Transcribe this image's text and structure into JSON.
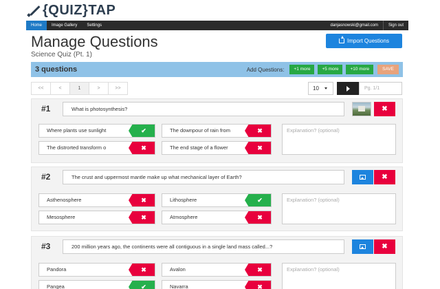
{
  "app": {
    "logo_text": "{QUIZ}TAP"
  },
  "nav": {
    "home": "Home",
    "gallery": "Image Gallery",
    "settings": "Settings",
    "email": "danjasnowski@gmail.com",
    "signout": "Sign out"
  },
  "page": {
    "title": "Manage Questions",
    "subtitle": "Science Quiz (Pt. 1)",
    "import_label": "Import Questions"
  },
  "qbar": {
    "count": "3 questions",
    "add_label": "Add Questions:",
    "add_buttons": [
      "+1 more",
      "+5 more",
      "+10 more"
    ],
    "save": "SAVE"
  },
  "pager": {
    "first": "<<",
    "prev": "<",
    "current": "1",
    "next": ">",
    "last": ">>",
    "per_page": "10",
    "page_placeholder": "Pg. 1/1"
  },
  "colors": {
    "accent": "#1d84de",
    "correct": "#25b04c",
    "wrong": "#e8003d",
    "nav_bg": "#2b2b2b",
    "qbar_bg": "#8fc2e7"
  },
  "questions": [
    {
      "number": "#1",
      "text": "What is photosynthesis?",
      "has_image": true,
      "answers": [
        {
          "text": "Where plants use sunlight",
          "correct": true
        },
        {
          "text": "The downpour of rain from",
          "correct": false
        },
        {
          "text": "The distrorted transform o",
          "correct": false
        },
        {
          "text": "The end stage of a flower",
          "correct": false
        }
      ],
      "explanation_placeholder": "Explanation? (optional)"
    },
    {
      "number": "#2",
      "text": "The crust and uppermost mantle make up what mechanical layer of Earth?",
      "has_image": false,
      "answers": [
        {
          "text": "Asthenosphere",
          "correct": false
        },
        {
          "text": "Lithosphere",
          "correct": true
        },
        {
          "text": "Mesosphere",
          "correct": false
        },
        {
          "text": "Atmosphere",
          "correct": false
        }
      ],
      "explanation_placeholder": "Explanation? (optional)"
    },
    {
      "number": "#3",
      "text": "200 million years ago, the continents were all contiguous in a single land mass called...?",
      "has_image": false,
      "answers": [
        {
          "text": "Pandora",
          "correct": false
        },
        {
          "text": "Avalon",
          "correct": false
        },
        {
          "text": "Pangea",
          "correct": true
        },
        {
          "text": "Navarra",
          "correct": false
        }
      ],
      "explanation_placeholder": "Explanation? (optional)"
    }
  ]
}
